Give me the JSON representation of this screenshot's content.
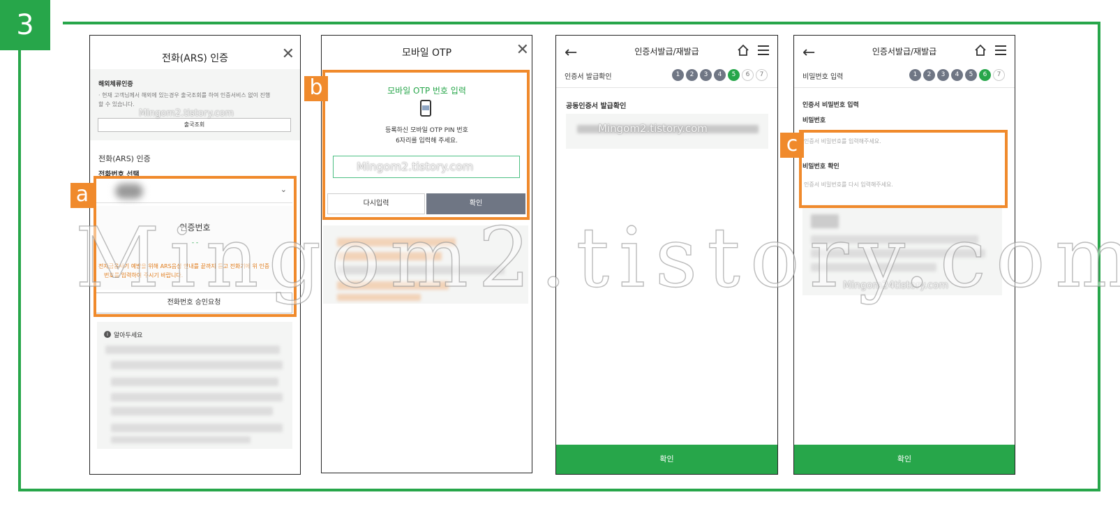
{
  "step_number": "3",
  "labels": {
    "a": "a",
    "b": "b",
    "c": "c"
  },
  "watermark": {
    "big": "Mingom2.tistory.com",
    "small": "Mingom2.tistory.com",
    "small_alt": "Mingom24tistory.com"
  },
  "colors": {
    "accent": "#27a64a",
    "highlight": "#f08a2c",
    "step_done": "#6f7684"
  },
  "panel1": {
    "title": "전화(ARS) 인증",
    "overseas_title": "해외체류인증",
    "overseas_desc_1": "· 현재 고객님께서 해외에 있는경우 출국조회를 하여 인증서비스 없이 진행",
    "overseas_desc_2": "할 수 있습니다.",
    "overseas_button": "출국조회",
    "ars_section": "전화(ARS) 인증",
    "phone_select_label": "전화번호 선택",
    "auth_number_label": "인증번호",
    "auth_number_value": "- -",
    "warning_1": "전자금융사기 예방을 위해 ARS음성 안내를 끝까지 듣고 전화기에 위 인증",
    "warning_2": "번호를 입력하여 주시기 바랍니다.",
    "request_button": "전화번호 승인요청",
    "notice_title": "알아두세요"
  },
  "panel2": {
    "title": "모바일 OTP",
    "otp_heading": "모바일 OTP 번호 입력",
    "otp_desc_1": "등록하신 모바일 OTP PIN 번호",
    "otp_desc_2": "6자리를 입력해 주세요.",
    "reenter_button": "다시입력",
    "confirm_button": "확인"
  },
  "panel3": {
    "title": "인증서발급/재발급",
    "step_label": "인증서 발급확인",
    "steps": [
      "1",
      "2",
      "3",
      "4",
      "5",
      "6",
      "7"
    ],
    "active_step": "5",
    "section_title": "공동인증서 발급확인",
    "confirm_button": "확인"
  },
  "panel4": {
    "title": "인증서발급/재발급",
    "step_label": "비밀번호 입력",
    "steps": [
      "1",
      "2",
      "3",
      "4",
      "5",
      "6",
      "7"
    ],
    "active_step": "6",
    "section_title": "인증서 비밀번호 입력",
    "password_label": "비밀번호",
    "password_placeholder": "인증서 비밀번호를 입력해주세요.",
    "confirm_label": "비밀번호 확인",
    "confirm_placeholder": "인증서 비밀번호를 다시 입력해주세요.",
    "confirm_button": "확인"
  }
}
